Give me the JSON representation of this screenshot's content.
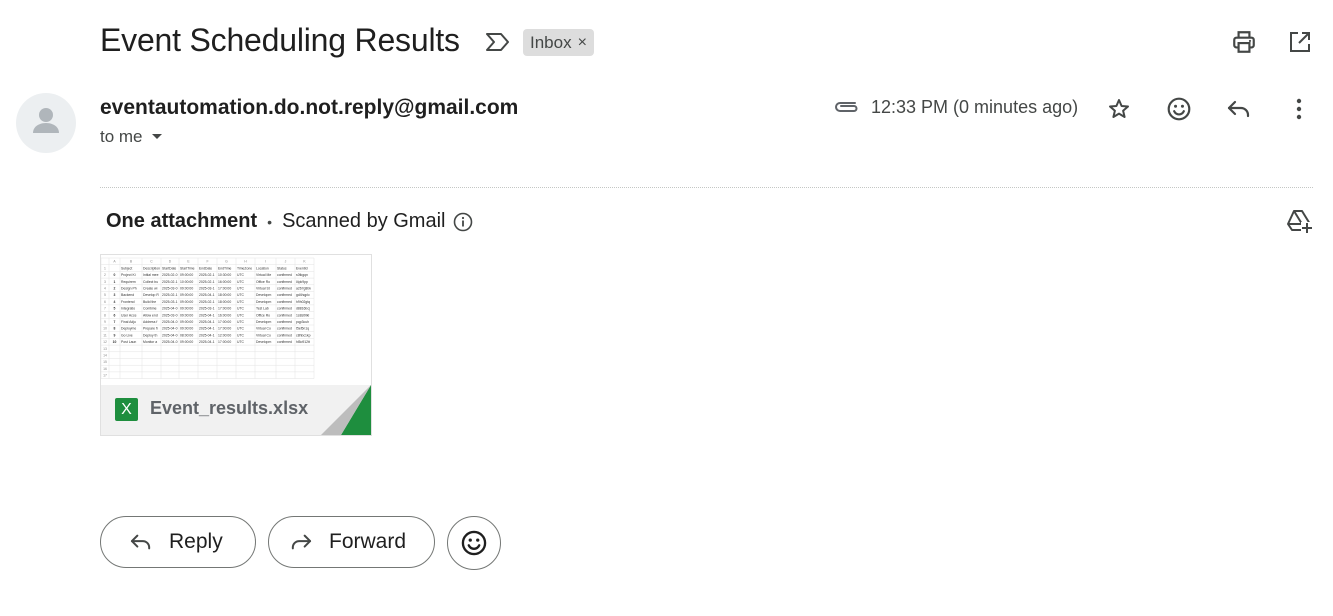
{
  "email": {
    "subject": "Event Scheduling Results",
    "label": "Inbox",
    "label_remove": "×",
    "sender": "eventautomation.do.not.reply@gmail.com",
    "recipient": "to me",
    "timestamp": "12:33 PM (0 minutes ago)"
  },
  "attachments": {
    "count_label": "One attachment",
    "separator": "•",
    "scan_label": "Scanned by Gmail",
    "file": {
      "name": "Event_results.xlsx",
      "type_icon": "X",
      "preview": {
        "columns": [
          "A",
          "B",
          "C",
          "D",
          "E",
          "F",
          "G",
          "H",
          "I",
          "J",
          "K"
        ],
        "headers": [
          "Subject",
          "Description",
          "StartDate",
          "StartTime",
          "EndDate",
          "EndTime",
          "TimeZone",
          "Location",
          "Status",
          "EventId"
        ],
        "rows": [
          [
            "0",
            "Project Ki",
            "Initial mee",
            "2025-02-0",
            "09:00:00",
            "2025-02-1",
            "10:30:00",
            "UTC",
            "Virtual Me",
            "confirmed",
            "s0tkgqn"
          ],
          [
            "1",
            "Requirem",
            "Collect bu",
            "2025-02-1",
            "10:00:00",
            "2025-02-1",
            "16:00:00",
            "UTC",
            "Office Ro",
            "confirmed",
            "l4pk9pp"
          ],
          [
            "2",
            "Design Ph",
            "Create wi",
            "2025-03-0",
            "09:00:00",
            "2025-03-1",
            "17:00:00",
            "UTC",
            "Virtual St",
            "confirmed",
            "a267g8bk"
          ],
          [
            "3",
            "Backend",
            "Develop R",
            "2025-02-1",
            "09:00:00",
            "2025-04-1",
            "18:00:00",
            "UTC",
            "Developm",
            "confirmed",
            "gd4hqplc"
          ],
          [
            "4",
            "Frontend",
            "Build the",
            "2025-03-1",
            "09:00:00",
            "2025-02-1",
            "18:00:00",
            "UTC",
            "Developm",
            "confirmed",
            "h9h02gtq"
          ],
          [
            "5",
            "Integratio",
            "Combine",
            "2025-04-0",
            "09:00:00",
            "2025-03-1",
            "17:00:00",
            "UTC",
            "Test Lab",
            "confirmed",
            "d8816bcj"
          ],
          [
            "6",
            "User Acce",
            "Allow end",
            "2025-03-0",
            "09:00:00",
            "2025-04-1",
            "16:00:00",
            "UTC",
            "Office Ro",
            "confirmed",
            "1s8sl9tkl"
          ],
          [
            "7",
            "Final Adju",
            "Address f",
            "2025-04-0",
            "09:00:00",
            "2025-04-1",
            "17:00:00",
            "UTC",
            "Developm",
            "confirmed",
            "pqp3cuh"
          ],
          [
            "8",
            "Deployme",
            "Prepare fi",
            "2025-04-0",
            "09:00:00",
            "2025-04-1",
            "17:00:00",
            "UTC",
            "Virtual Co",
            "confirmed",
            "t5el5n1q"
          ],
          [
            "9",
            "Go Live",
            "Deploy th",
            "2025-04-0",
            "08:00:00",
            "2025-04-1",
            "12:00:00",
            "UTC",
            "Virtual Co",
            "confirmed",
            "c8hbc1kp"
          ],
          [
            "10",
            "Post Laun",
            "Monitor a",
            "2025-04-0",
            "09:00:00",
            "2025-04-1",
            "17:00:00",
            "UTC",
            "Developm",
            "confirmed",
            "hl5o912tt"
          ]
        ]
      }
    }
  },
  "actions": {
    "reply": "Reply",
    "forward": "Forward"
  },
  "icons": {
    "importance": "importance-marker-icon",
    "print": "print-icon",
    "open_new_window": "open-in-new-window-icon",
    "attachment": "paperclip-icon",
    "star": "star-icon",
    "emoji": "emoji-smile-icon",
    "reply": "reply-arrow-icon",
    "more": "more-vertical-icon",
    "info": "info-icon",
    "drive": "add-to-drive-icon",
    "forward": "forward-arrow-icon"
  },
  "colors": {
    "excel_green": "#1e8e3e",
    "chip_bg": "#dddddd",
    "text_primary": "#1f1f1f",
    "text_secondary": "#444746"
  }
}
